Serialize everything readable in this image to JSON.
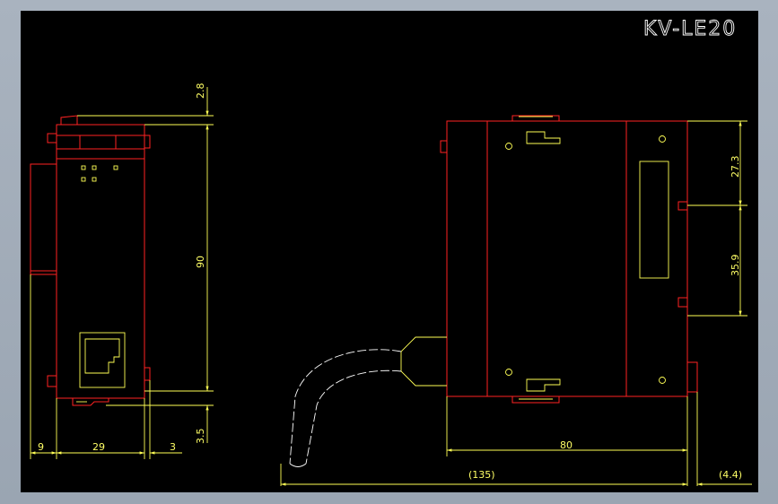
{
  "drawing": {
    "title": "KV-LE20",
    "colors": {
      "background": "#000000",
      "frame": "#a9b3bf",
      "outline": "#ff2222",
      "dimension": "#ffff55",
      "annotation": "#ffffff"
    },
    "dimensions": {
      "top_offset": "2.8",
      "height": "90",
      "bottom_offset": "3.5",
      "left_width": "9",
      "body_width": "29",
      "right_width": "3",
      "upper_pitch": "27.3",
      "lower_pitch": "35.9",
      "depth": "80",
      "cable_length": "(135)",
      "rail_offset": "(4.4)"
    }
  }
}
